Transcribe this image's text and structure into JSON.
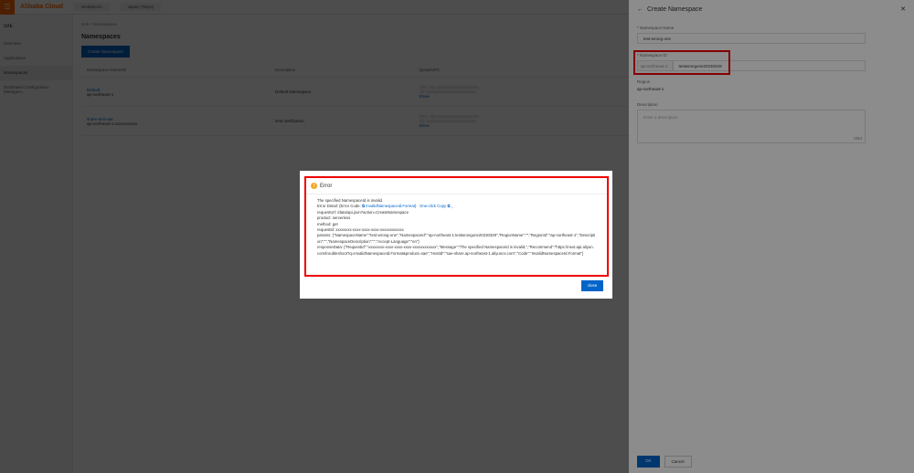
{
  "topbar": {
    "logo": "Alibaba Cloud",
    "workbench": "Workbench",
    "region": "Japan (Tokyo)"
  },
  "sidebar": {
    "title": "SAE",
    "items": [
      "Overview",
      "Applications",
      "Namespaces",
      "Distributed Configuration Managem..."
    ]
  },
  "main": {
    "breadcrumb": "SAE / Namespaces",
    "title": "Namespaces",
    "create_button": "Create Namespace",
    "columns": [
      "Namespace Name/ID",
      "Description",
      "Quota/VPC"
    ],
    "rows": [
      {
        "name": "Default",
        "id": "ap-northeast-1",
        "description": "Default Namespace",
        "vpc1": "VPC: vpc-xxxxxxxxxxxxxxxxxxxx",
        "vpc2": "AZ: xxxxxxxxxxxxxxxxxxxxxxxx",
        "show": "Show"
      },
      {
        "name": "share-test-sae",
        "id": "ap-northeast-1:xxxxxxxxxxx",
        "description": "SAE verification",
        "vpc1": "VPC: vpc-xxxxxxxxxxxxxxxxxxxx",
        "vpc2": "AZ: xxxxxxxxxxxxxxxxxxxxxxxx",
        "show": "Show"
      }
    ]
  },
  "drawer": {
    "title": "Create Namespace",
    "name_label": "Namespace Name",
    "name_value": "test-wrong-one",
    "id_label": "Namespace ID",
    "id_prefix": "ap-northeast-1:",
    "id_value": "testwrongone20230329",
    "region_label": "Region",
    "region_value": "ap-northeast-1",
    "desc_label": "Description",
    "desc_placeholder": "Enter a description.",
    "desc_count": "0/64",
    "ok": "OK",
    "cancel": "Cancel"
  },
  "modal": {
    "title": "Error",
    "lines": {
      "msg": "The specified NamespaceId is invalid.",
      "detail_prefix": "Error Detail: (Error Code:",
      "code": "InvalidNamespaceId.Format",
      "detail_suffix": ")",
      "copy": "One-click Copy",
      "url": "requestUrl: /data/api.json?action=CreateNamespace",
      "product": "product: serverless",
      "method": "method: get",
      "reqid": "requestId: xxxxxxxx-xxxx-xxxx-xxxx-xxxxxxxxxxxx",
      "params": "params: {\"NamespaceName\":\"test-wrong-one\",\"NamespaceId\":\"ap-northeast-1:testwrongone20230329\",\"RegionName\":\"\",\"RegionId\":\"ap-northeast-1\",\"Description\":\"\",\"NamespaceDescription\":\"\",\"Accept-Language\":\"en\"}",
      "response": "responseData: {\"RequestId\":\"xxxxxxxx-xxxx-xxxx-xxxx-xxxxxxxxxxxx\",\"Message\":\"The specified NamespaceId is invalid.\",\"Recommend\":\"https://next.api.aliyun.com/troubleshoot?q=InvalidNamespaceId.Format&product=sae\",\"HostId\":\"sae-share.ap-northeast-1.aliyuncs.com\",\"Code\":\"InvalidNamespaceId.Format\"}"
    },
    "close": "close"
  }
}
